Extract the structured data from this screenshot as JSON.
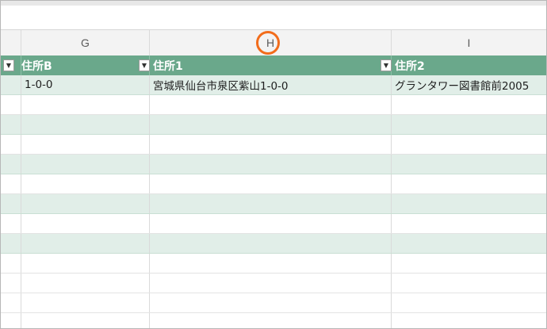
{
  "columns": {
    "g": "G",
    "h": "H",
    "i": "I"
  },
  "table": {
    "headers": [
      "住所B",
      "住所1",
      "住所2"
    ],
    "rows": [
      [
        "1-0-0",
        "宮城県仙台市泉区紫山1-0-0",
        "グランタワー図書館前2005"
      ]
    ]
  },
  "icons": {
    "filter": "filter-dropdown-icon",
    "highlight": "highlight-circle"
  },
  "colors": {
    "header_fill": "#6aa88b",
    "band_fill": "#e1eee8",
    "highlight_ring": "#f26c1b"
  }
}
